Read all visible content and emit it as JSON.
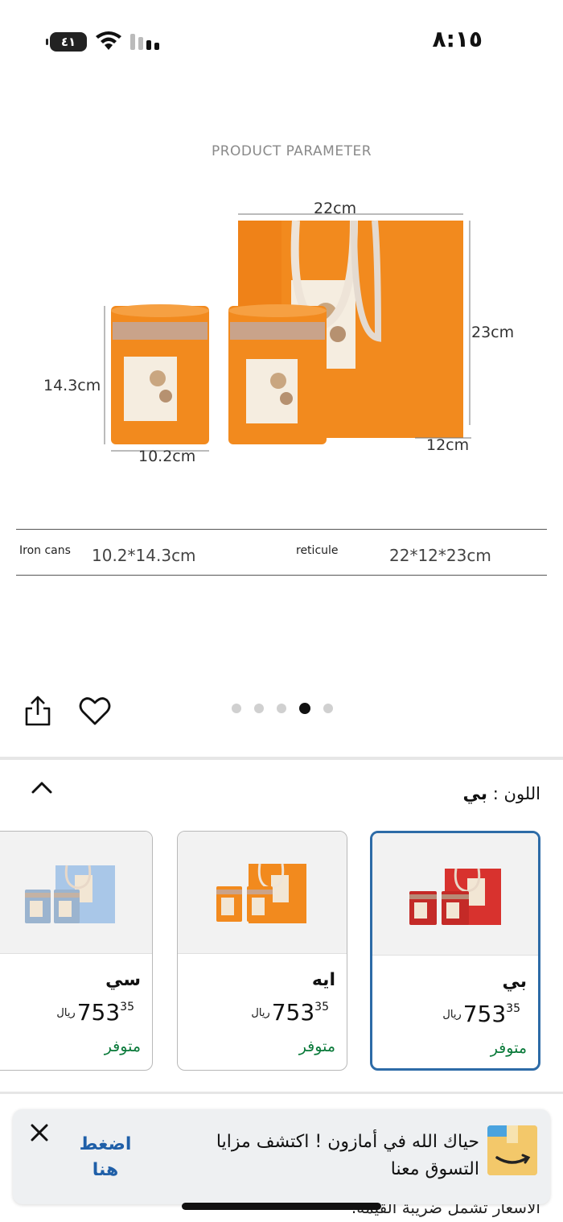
{
  "status_bar": {
    "battery": "٤١",
    "time": "٨:١٥"
  },
  "product_image": {
    "section_title": "PRODUCT PARAMETER",
    "dims": {
      "bag_width": "22cm",
      "bag_height": "23cm",
      "bag_depth": "12cm",
      "can_height": "14.3cm",
      "can_width": "10.2cm"
    },
    "spec_table": {
      "iron_cans_label": "Iron cans",
      "iron_cans_value": "10.2*14.3cm",
      "reticule_label": "reticule",
      "reticule_value": "22*12*23cm"
    },
    "carousel": {
      "total": 5,
      "active_index": 3
    }
  },
  "colors": {
    "orange": "#f28a1e",
    "red": "#d8322e",
    "blue_box": "#a9c7e8",
    "accent_blue": "#2d6ba7",
    "in_stock_green": "#0a7a3a"
  },
  "color_selector": {
    "label": "اللون",
    "separator": ":",
    "selected": "بي"
  },
  "variants": [
    {
      "name": "بي",
      "price_whole": "753",
      "price_fraction": "35",
      "currency": "ريال",
      "stock": "متوفر",
      "swatch": "red",
      "selected": true
    },
    {
      "name": "ايه",
      "price_whole": "753",
      "price_fraction": "35",
      "currency": "ريال",
      "stock": "متوفر",
      "swatch": "orange",
      "selected": false
    },
    {
      "name": "سي",
      "price_whole": "753",
      "price_fraction": "35",
      "currency": "ريال",
      "stock": "متوفر",
      "swatch": "blue",
      "selected": false
    }
  ],
  "banner": {
    "message": "حياك الله في أمازون ! اكتشف مزايا التسوق معنا",
    "cta": "اضغط هنا"
  },
  "footer": {
    "tax_note": "الأسعار تشمل ضريبة القيمة."
  }
}
